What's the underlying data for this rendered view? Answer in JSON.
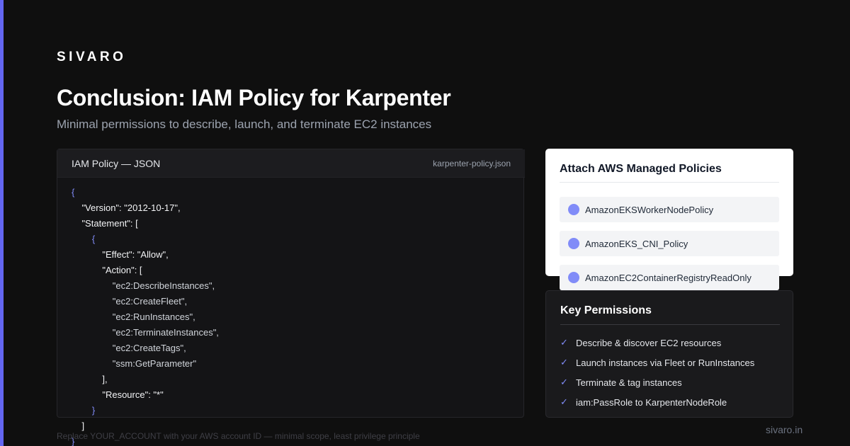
{
  "brand": {
    "logo": "SIVARO",
    "domain": "sivaro.in",
    "accent_color": "#6366f1"
  },
  "header": {
    "title": "Conclusion: IAM Policy for Karpenter",
    "subtitle": "Minimal permissions to describe, launch, and terminate EC2 instances"
  },
  "code_panel": {
    "title": "IAM Policy — JSON",
    "filename": "karpenter-policy.json",
    "lines": [
      "{",
      "    \"Version\": \"2012-10-17\",",
      "    \"Statement\": [",
      "        {",
      "            \"Effect\": \"Allow\",",
      "            \"Action\": [",
      "                \"ec2:DescribeInstances\",",
      "                \"ec2:CreateFleet\",",
      "                \"ec2:RunInstances\",",
      "                \"ec2:TerminateInstances\",",
      "                \"ec2:CreateTags\",",
      "                \"ssm:GetParameter\"",
      "            ],",
      "            \"Resource\": \"*\"",
      "        }",
      "    ]",
      "}"
    ]
  },
  "managed_policies": {
    "title": "Attach AWS Managed Policies",
    "items": [
      {
        "label": "AmazonEKSWorkerNodePolicy"
      },
      {
        "label": "AmazonEKS_CNI_Policy"
      },
      {
        "label": "AmazonEC2ContainerRegistryReadOnly"
      }
    ]
  },
  "key_permissions": {
    "title": "Key Permissions",
    "icon": "check-icon",
    "check_glyph": "✓",
    "items": [
      {
        "label": "Describe & discover EC2 resources"
      },
      {
        "label": "Launch instances via Fleet or RunInstances"
      },
      {
        "label": "Terminate & tag instances"
      },
      {
        "label": "iam:PassRole to KarpenterNodeRole"
      }
    ]
  },
  "footer": {
    "note": "Replace YOUR_ACCOUNT with your AWS account ID — minimal scope, least privilege principle"
  }
}
